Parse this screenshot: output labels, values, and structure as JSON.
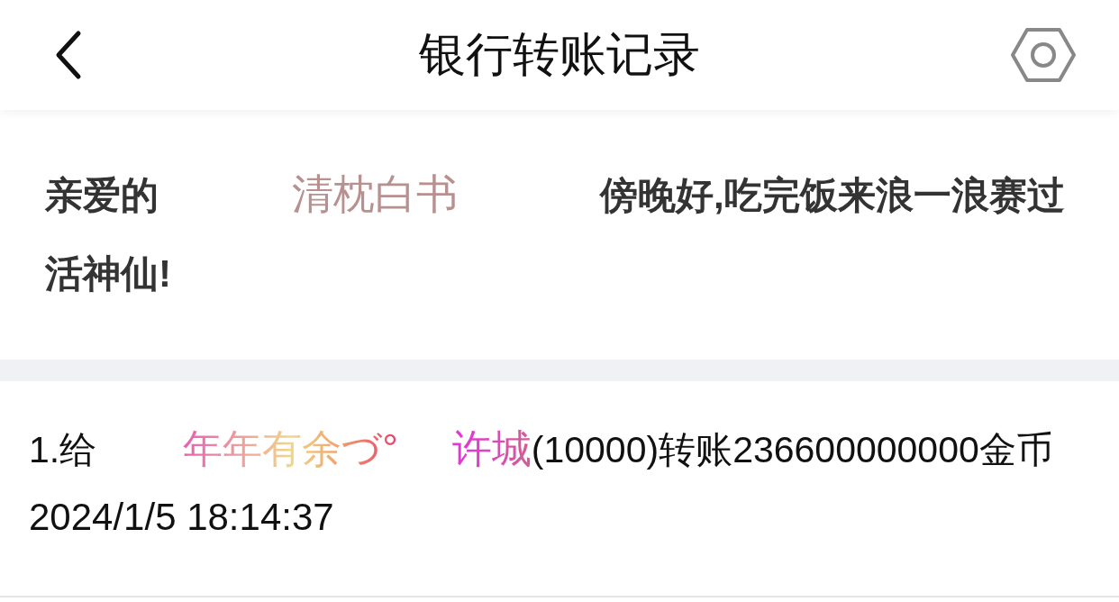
{
  "header": {
    "title": "银行转账记录"
  },
  "greeting": {
    "prefix": "亲爱的",
    "name": "清枕白书",
    "message": "傍晚好,吃完饭来浪一浪赛过活神仙!"
  },
  "records": [
    {
      "index": "1.给",
      "sender": "年年有余づ°",
      "receiver": "许城",
      "detail": "(10000)转账236600000000金币",
      "time": "2024/1/5 18:14:37"
    }
  ]
}
